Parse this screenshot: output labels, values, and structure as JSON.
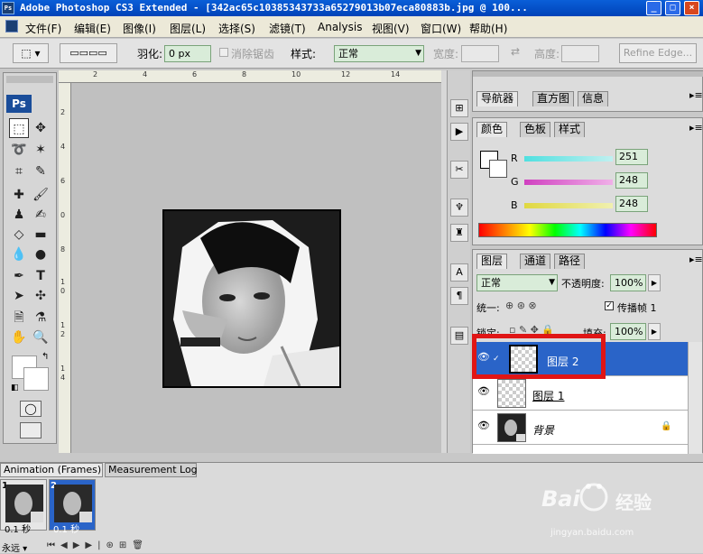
{
  "title_bar": {
    "logo": "Ps",
    "title": "Adobe Photoshop CS3 Extended - [342ac65c10385343733a65279013b07eca80883b.jpg @ 100...",
    "buttons": [
      "_",
      "□",
      "×"
    ]
  },
  "menu": {
    "items": [
      "文件(F)",
      "编辑(E)",
      "图像(I)",
      "图层(L)",
      "选择(S)",
      "滤镜(T)",
      "Analysis",
      "视图(V)",
      "窗口(W)",
      "帮助(H)"
    ]
  },
  "options": {
    "feather_label": "羽化:",
    "feather_value": "0 px",
    "antialias_label": "消除锯齿",
    "style_label": "样式:",
    "style_value": "正常",
    "width_label": "宽度:",
    "height_label": "高度:",
    "refine_edge": "Refine Edge..."
  },
  "toolbox": {
    "logo": "Ps",
    "tools": [
      "marquee-icon",
      "move-icon",
      "lasso-icon",
      "magic-wand-icon",
      "crop-icon",
      "slice-icon",
      "healing-icon",
      "brush-icon",
      "stamp-icon",
      "history-brush-icon",
      "eraser-icon",
      "gradient-icon",
      "blur-icon",
      "dodge-icon",
      "pen-icon",
      "type-icon",
      "path-select-icon",
      "shape-icon",
      "notes-icon",
      "eyedropper-icon",
      "hand-icon",
      "zoom-icon"
    ]
  },
  "rulers": {
    "top": [
      "2",
      "4",
      "6",
      "8",
      "10",
      "12",
      "14"
    ],
    "left": [
      "2",
      "4",
      "6",
      "0",
      "8",
      "1",
      "0",
      "1",
      "2",
      "1",
      "4"
    ]
  },
  "navigator_panel": {
    "tabs": [
      "导航器",
      "直方图",
      "信息"
    ]
  },
  "color_panel": {
    "tabs": [
      "颜色",
      "色板",
      "样式"
    ],
    "channels": [
      {
        "label": "R",
        "value": "251",
        "color": "#4ad8d8"
      },
      {
        "label": "G",
        "value": "248",
        "color": "#d850c8"
      },
      {
        "label": "B",
        "value": "248",
        "color": "#e8e050"
      }
    ]
  },
  "layers_panel": {
    "tabs": [
      "图层",
      "通道",
      "路径"
    ],
    "blend_mode": "正常",
    "opacity_label": "不透明度:",
    "opacity_value": "100%",
    "unify_label": "统一:",
    "propagate_label": "传播帧 1",
    "lock_label": "锁定:",
    "fill_label": "填充:",
    "fill_value": "100%",
    "layers": [
      {
        "name": "图层 2",
        "selected": true
      },
      {
        "name": "图层 1",
        "selected": false
      },
      {
        "name": "背景",
        "selected": false
      }
    ]
  },
  "animation_panel": {
    "tabs": [
      "Animation (Frames)",
      "Measurement Log"
    ],
    "frames": [
      {
        "number": "1",
        "delay": "0.1 秒"
      },
      {
        "number": "2",
        "delay": "0.1 秒"
      }
    ],
    "loop": "永远"
  },
  "watermark": {
    "brand": "Bai",
    "brand_cn": "经验",
    "url": "jingyan.baidu.com"
  },
  "colors": {
    "title_bar": "#0042b8",
    "highlight_red": "#e01515",
    "selected_layer": "#2a64c8"
  }
}
